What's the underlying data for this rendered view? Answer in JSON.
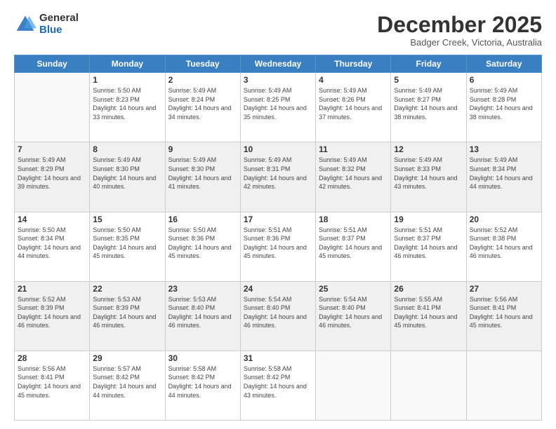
{
  "header": {
    "logo_general": "General",
    "logo_blue": "Blue",
    "month": "December 2025",
    "location": "Badger Creek, Victoria, Australia"
  },
  "days_of_week": [
    "Sunday",
    "Monday",
    "Tuesday",
    "Wednesday",
    "Thursday",
    "Friday",
    "Saturday"
  ],
  "weeks": [
    [
      {
        "day": "",
        "empty": true
      },
      {
        "day": "1",
        "sunrise": "Sunrise: 5:50 AM",
        "sunset": "Sunset: 8:23 PM",
        "daylight": "Daylight: 14 hours and 33 minutes."
      },
      {
        "day": "2",
        "sunrise": "Sunrise: 5:49 AM",
        "sunset": "Sunset: 8:24 PM",
        "daylight": "Daylight: 14 hours and 34 minutes."
      },
      {
        "day": "3",
        "sunrise": "Sunrise: 5:49 AM",
        "sunset": "Sunset: 8:25 PM",
        "daylight": "Daylight: 14 hours and 35 minutes."
      },
      {
        "day": "4",
        "sunrise": "Sunrise: 5:49 AM",
        "sunset": "Sunset: 8:26 PM",
        "daylight": "Daylight: 14 hours and 37 minutes."
      },
      {
        "day": "5",
        "sunrise": "Sunrise: 5:49 AM",
        "sunset": "Sunset: 8:27 PM",
        "daylight": "Daylight: 14 hours and 38 minutes."
      },
      {
        "day": "6",
        "sunrise": "Sunrise: 5:49 AM",
        "sunset": "Sunset: 8:28 PM",
        "daylight": "Daylight: 14 hours and 38 minutes."
      }
    ],
    [
      {
        "day": "7",
        "sunrise": "Sunrise: 5:49 AM",
        "sunset": "Sunset: 8:29 PM",
        "daylight": "Daylight: 14 hours and 39 minutes."
      },
      {
        "day": "8",
        "sunrise": "Sunrise: 5:49 AM",
        "sunset": "Sunset: 8:30 PM",
        "daylight": "Daylight: 14 hours and 40 minutes."
      },
      {
        "day": "9",
        "sunrise": "Sunrise: 5:49 AM",
        "sunset": "Sunset: 8:30 PM",
        "daylight": "Daylight: 14 hours and 41 minutes."
      },
      {
        "day": "10",
        "sunrise": "Sunrise: 5:49 AM",
        "sunset": "Sunset: 8:31 PM",
        "daylight": "Daylight: 14 hours and 42 minutes."
      },
      {
        "day": "11",
        "sunrise": "Sunrise: 5:49 AM",
        "sunset": "Sunset: 8:32 PM",
        "daylight": "Daylight: 14 hours and 42 minutes."
      },
      {
        "day": "12",
        "sunrise": "Sunrise: 5:49 AM",
        "sunset": "Sunset: 8:33 PM",
        "daylight": "Daylight: 14 hours and 43 minutes."
      },
      {
        "day": "13",
        "sunrise": "Sunrise: 5:49 AM",
        "sunset": "Sunset: 8:34 PM",
        "daylight": "Daylight: 14 hours and 44 minutes."
      }
    ],
    [
      {
        "day": "14",
        "sunrise": "Sunrise: 5:50 AM",
        "sunset": "Sunset: 8:34 PM",
        "daylight": "Daylight: 14 hours and 44 minutes."
      },
      {
        "day": "15",
        "sunrise": "Sunrise: 5:50 AM",
        "sunset": "Sunset: 8:35 PM",
        "daylight": "Daylight: 14 hours and 45 minutes."
      },
      {
        "day": "16",
        "sunrise": "Sunrise: 5:50 AM",
        "sunset": "Sunset: 8:36 PM",
        "daylight": "Daylight: 14 hours and 45 minutes."
      },
      {
        "day": "17",
        "sunrise": "Sunrise: 5:51 AM",
        "sunset": "Sunset: 8:36 PM",
        "daylight": "Daylight: 14 hours and 45 minutes."
      },
      {
        "day": "18",
        "sunrise": "Sunrise: 5:51 AM",
        "sunset": "Sunset: 8:37 PM",
        "daylight": "Daylight: 14 hours and 45 minutes."
      },
      {
        "day": "19",
        "sunrise": "Sunrise: 5:51 AM",
        "sunset": "Sunset: 8:37 PM",
        "daylight": "Daylight: 14 hours and 46 minutes."
      },
      {
        "day": "20",
        "sunrise": "Sunrise: 5:52 AM",
        "sunset": "Sunset: 8:38 PM",
        "daylight": "Daylight: 14 hours and 46 minutes."
      }
    ],
    [
      {
        "day": "21",
        "sunrise": "Sunrise: 5:52 AM",
        "sunset": "Sunset: 8:39 PM",
        "daylight": "Daylight: 14 hours and 46 minutes."
      },
      {
        "day": "22",
        "sunrise": "Sunrise: 5:53 AM",
        "sunset": "Sunset: 8:39 PM",
        "daylight": "Daylight: 14 hours and 46 minutes."
      },
      {
        "day": "23",
        "sunrise": "Sunrise: 5:53 AM",
        "sunset": "Sunset: 8:40 PM",
        "daylight": "Daylight: 14 hours and 46 minutes."
      },
      {
        "day": "24",
        "sunrise": "Sunrise: 5:54 AM",
        "sunset": "Sunset: 8:40 PM",
        "daylight": "Daylight: 14 hours and 46 minutes."
      },
      {
        "day": "25",
        "sunrise": "Sunrise: 5:54 AM",
        "sunset": "Sunset: 8:40 PM",
        "daylight": "Daylight: 14 hours and 46 minutes."
      },
      {
        "day": "26",
        "sunrise": "Sunrise: 5:55 AM",
        "sunset": "Sunset: 8:41 PM",
        "daylight": "Daylight: 14 hours and 45 minutes."
      },
      {
        "day": "27",
        "sunrise": "Sunrise: 5:56 AM",
        "sunset": "Sunset: 8:41 PM",
        "daylight": "Daylight: 14 hours and 45 minutes."
      }
    ],
    [
      {
        "day": "28",
        "sunrise": "Sunrise: 5:56 AM",
        "sunset": "Sunset: 8:41 PM",
        "daylight": "Daylight: 14 hours and 45 minutes."
      },
      {
        "day": "29",
        "sunrise": "Sunrise: 5:57 AM",
        "sunset": "Sunset: 8:42 PM",
        "daylight": "Daylight: 14 hours and 44 minutes."
      },
      {
        "day": "30",
        "sunrise": "Sunrise: 5:58 AM",
        "sunset": "Sunset: 8:42 PM",
        "daylight": "Daylight: 14 hours and 44 minutes."
      },
      {
        "day": "31",
        "sunrise": "Sunrise: 5:58 AM",
        "sunset": "Sunset: 8:42 PM",
        "daylight": "Daylight: 14 hours and 43 minutes."
      },
      {
        "day": "",
        "empty": true
      },
      {
        "day": "",
        "empty": true
      },
      {
        "day": "",
        "empty": true
      }
    ]
  ]
}
